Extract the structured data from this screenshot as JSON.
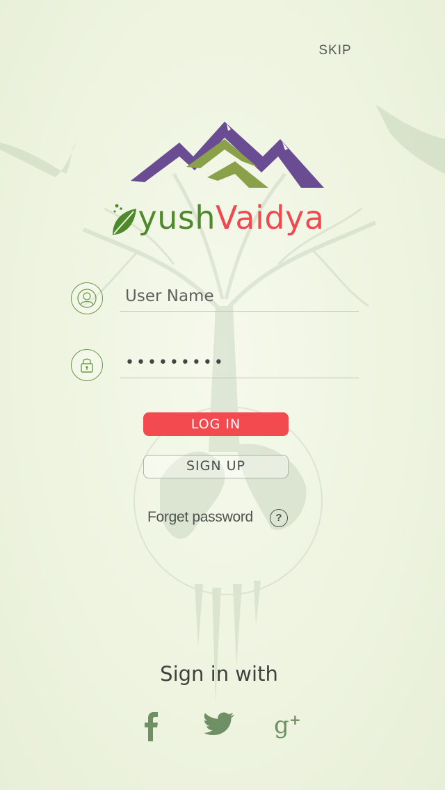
{
  "header": {
    "skip_label": "SKIP"
  },
  "logo": {
    "brand_part1": "yush",
    "brand_part2": "aidya",
    "brand_letter_a": "A",
    "brand_letter_v": "V",
    "colors": {
      "green": "#4e8a2c",
      "red": "#ef4a4f",
      "purple": "#6a4c93",
      "olive": "#8aa14a"
    }
  },
  "login_form": {
    "username": {
      "placeholder": "User Name",
      "value": "",
      "icon": "user-icon"
    },
    "password": {
      "value": "•••••••••",
      "icon": "lock-icon"
    },
    "login_label": "LOG IN",
    "signup_label": "SIGN UP",
    "forgot_label": "Forget password",
    "forgot_icon_glyph": "?"
  },
  "social": {
    "heading": "Sign in with",
    "providers": [
      {
        "name": "facebook",
        "icon": "facebook-icon"
      },
      {
        "name": "twitter",
        "icon": "twitter-icon"
      },
      {
        "name": "google-plus",
        "icon": "google-plus-icon"
      }
    ]
  },
  "colors": {
    "accent": "#f24a4e",
    "icon_green": "#6e9a48",
    "social_green": "#6f8f64",
    "background": "#eef4e0"
  }
}
